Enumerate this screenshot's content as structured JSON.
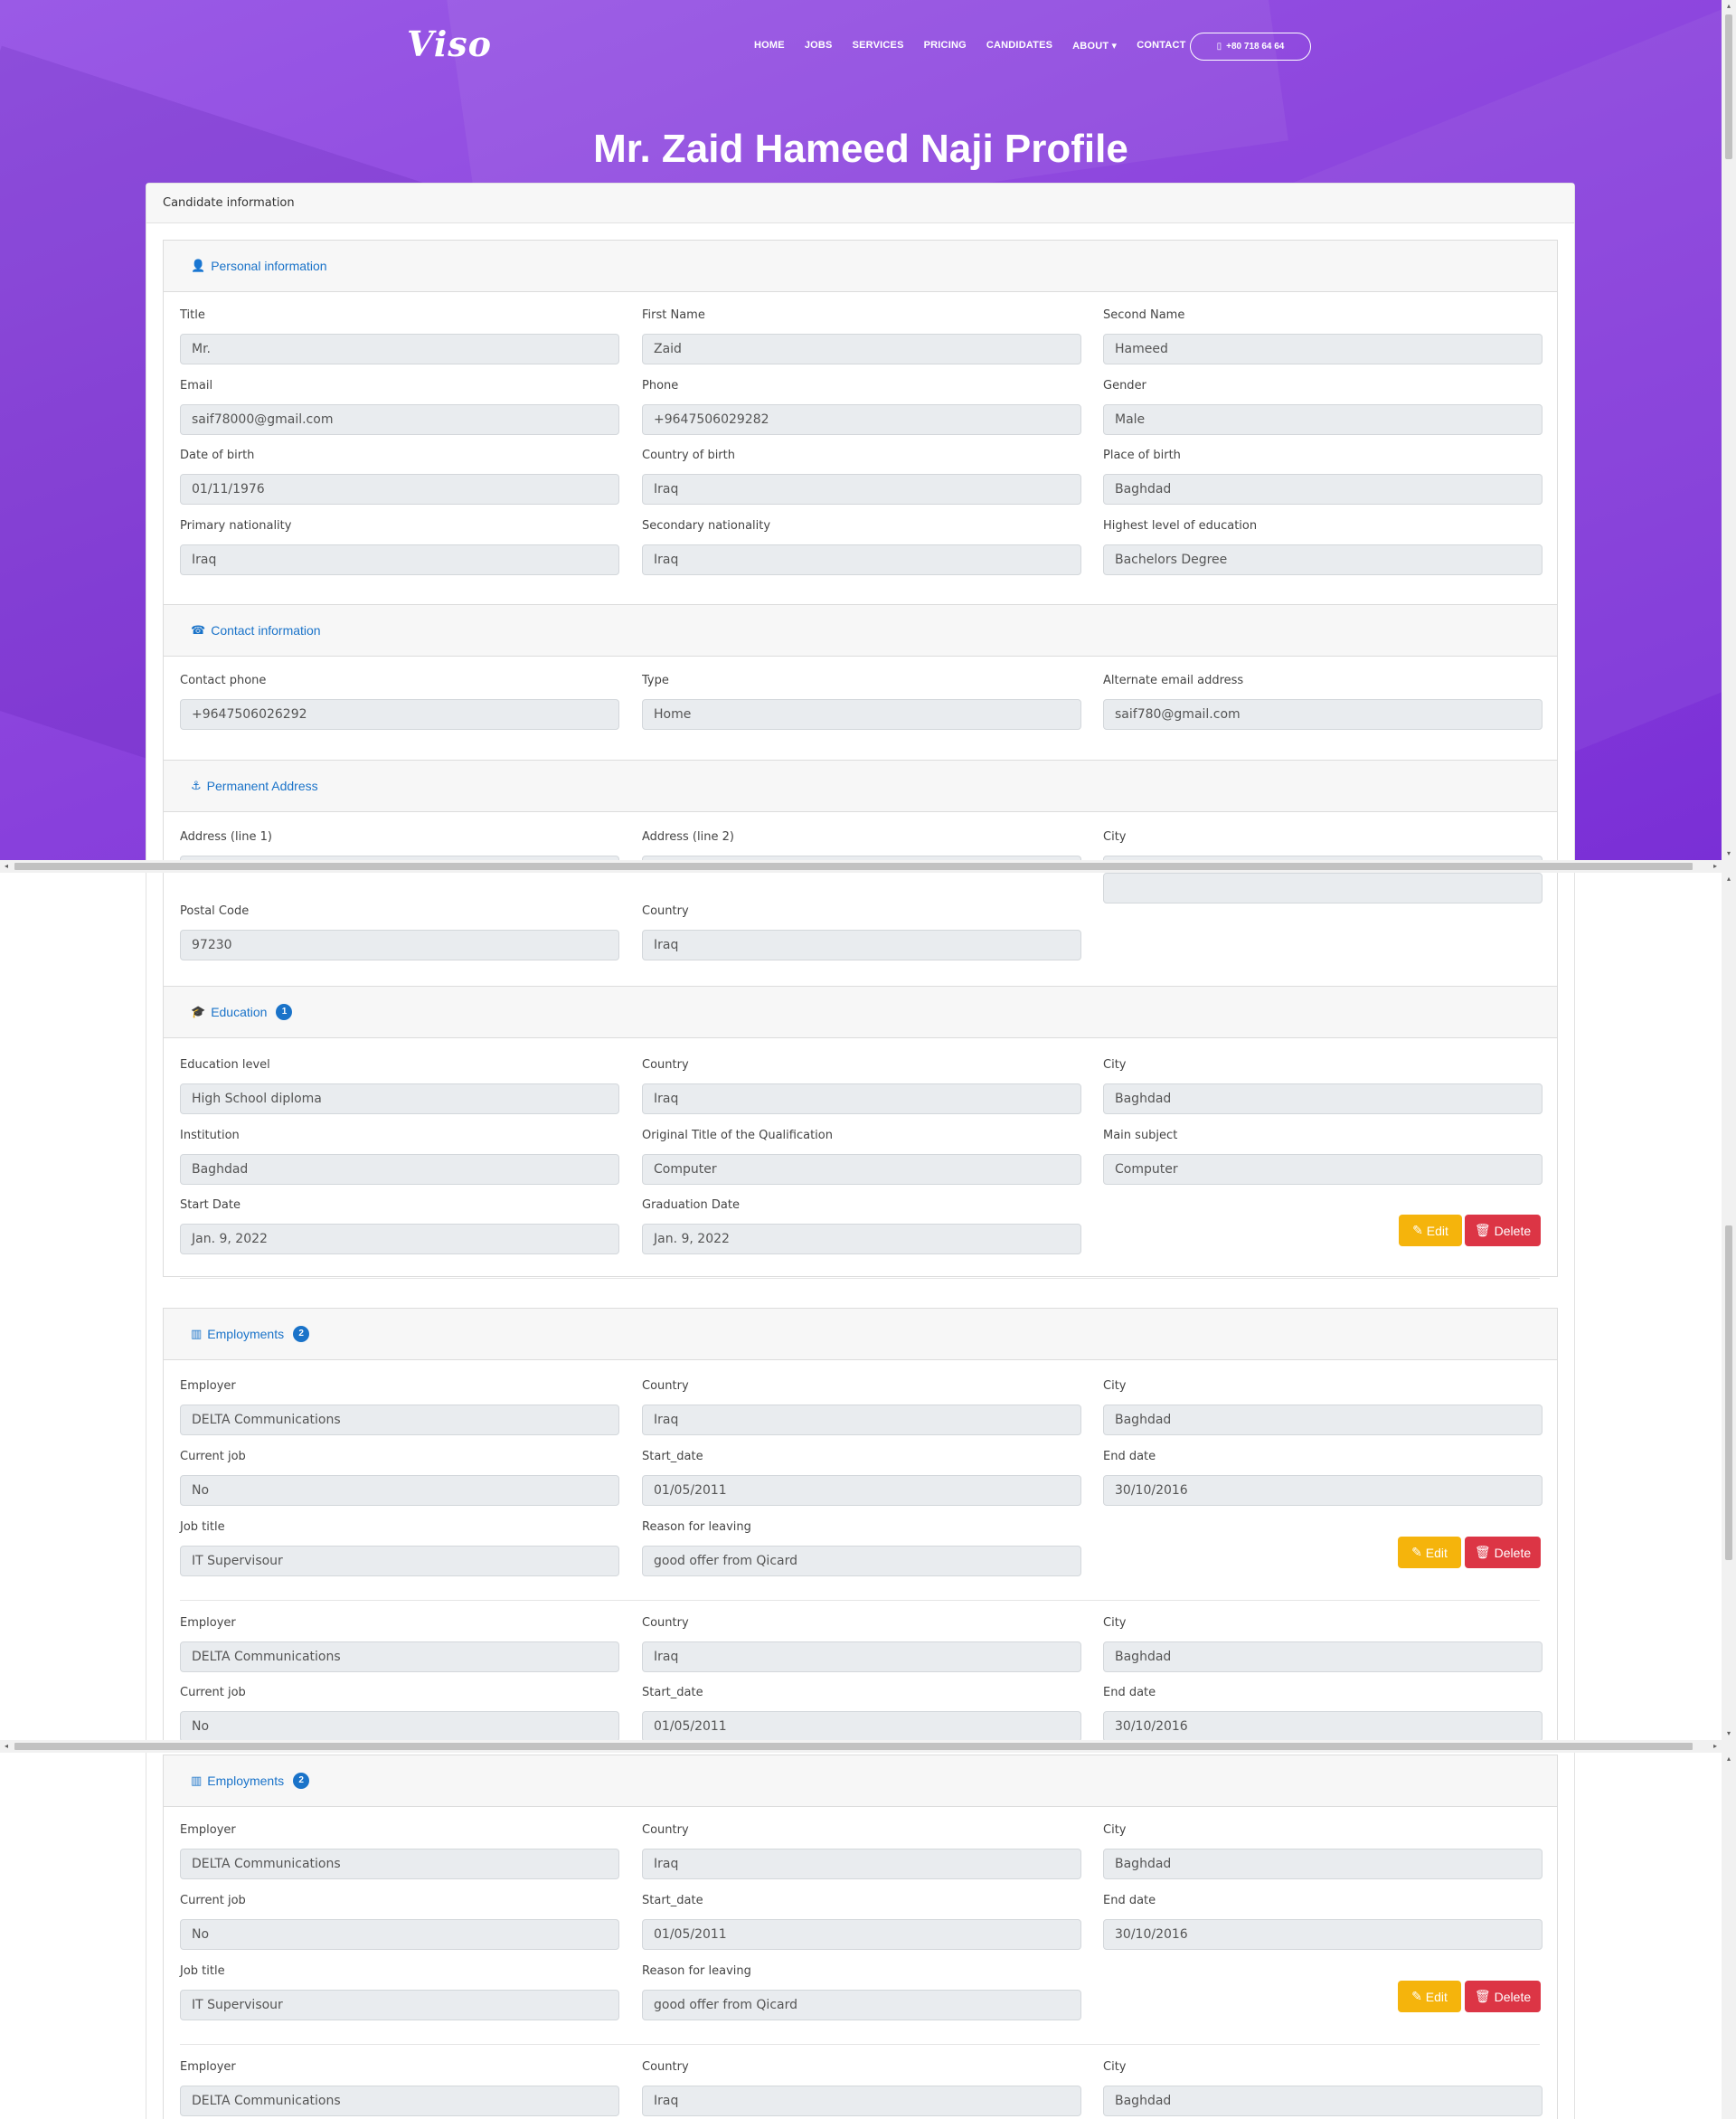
{
  "nav": {
    "logo": "Viso",
    "items": [
      "HOME",
      "JOBS",
      "SERVICES",
      "PRICING",
      "CANDIDATES",
      "ABOUT",
      "CONTACT"
    ],
    "phone": "+80 718 64 64"
  },
  "page_title": "Mr. Zaid Hameed Naji Profile",
  "card_header": "Candidate information",
  "personal": {
    "heading": "Personal information",
    "fields": [
      {
        "label": "Title",
        "value": "Mr."
      },
      {
        "label": "First Name",
        "value": "Zaid"
      },
      {
        "label": "Second Name",
        "value": "Hameed"
      },
      {
        "label": "Email",
        "value": "saif78000@gmail.com"
      },
      {
        "label": "Phone",
        "value": "+9647506029282"
      },
      {
        "label": "Gender",
        "value": "Male"
      },
      {
        "label": "Date of birth",
        "value": "01/11/1976"
      },
      {
        "label": "Country of birth",
        "value": "Iraq"
      },
      {
        "label": "Place of birth",
        "value": "Baghdad"
      },
      {
        "label": "Primary nationality",
        "value": "Iraq"
      },
      {
        "label": "Secondary nationality",
        "value": "Iraq"
      },
      {
        "label": "Highest level of education",
        "value": "Bachelors Degree"
      }
    ]
  },
  "contact": {
    "heading": "Contact information",
    "fields": [
      {
        "label": "Contact phone",
        "value": "+9647506026292"
      },
      {
        "label": "Type",
        "value": "Home"
      },
      {
        "label": "Alternate email address",
        "value": "saif780@gmail.com"
      }
    ]
  },
  "address": {
    "heading": "Permanent Address",
    "labels": [
      "Address (line 1)",
      "Address (line 2)",
      "City"
    ],
    "postal_label": "Postal Code",
    "postal_value": "97230",
    "country_label": "Country",
    "country_value": "Iraq"
  },
  "education": {
    "heading": "Education",
    "count": "1",
    "fields": [
      {
        "label": "Education level",
        "value": "High School diploma"
      },
      {
        "label": "Country",
        "value": "Iraq"
      },
      {
        "label": "City",
        "value": "Baghdad"
      },
      {
        "label": "Institution",
        "value": "Baghdad"
      },
      {
        "label": "Original Title of the Qualification",
        "value": "Computer"
      },
      {
        "label": "Main subject",
        "value": "Computer"
      },
      {
        "label": "Start Date",
        "value": "Jan. 9, 2022"
      },
      {
        "label": "Graduation Date",
        "value": "Jan. 9, 2022"
      }
    ]
  },
  "employments": {
    "heading": "Employments",
    "count": "2",
    "entry": {
      "employer_label": "Employer",
      "employer": "DELTA Communications",
      "country_label": "Country",
      "country": "Iraq",
      "city_label": "City",
      "city": "Baghdad",
      "current_label": "Current job",
      "current": "No",
      "start_label": "Start_date",
      "start": "01/05/2011",
      "end_label": "End date",
      "end": "30/10/2016",
      "title_label": "Job title",
      "title": "IT Supervisour",
      "reason_label": "Reason for leaving",
      "reason": "good offer from Qicard"
    }
  },
  "buttons": {
    "edit": "Edit",
    "delete": "Delete"
  }
}
